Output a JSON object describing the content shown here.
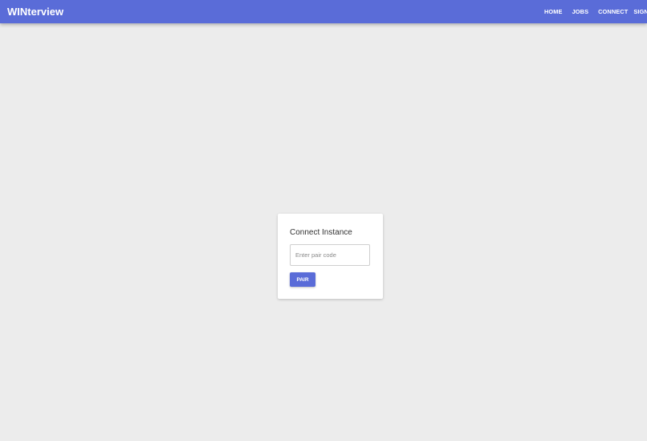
{
  "app": {
    "title": "WINterview"
  },
  "nav": {
    "items": [
      {
        "label": "HOME"
      },
      {
        "label": "JOBS"
      },
      {
        "label": "CONNECT"
      },
      {
        "label": "SIGN OU"
      }
    ]
  },
  "connect_card": {
    "title": "Connect Instance",
    "input_placeholder": "Enter pair code",
    "input_value": "",
    "button_label": "PAIR"
  },
  "colors": {
    "accent": "#5a6cd8",
    "background": "#ececec"
  }
}
